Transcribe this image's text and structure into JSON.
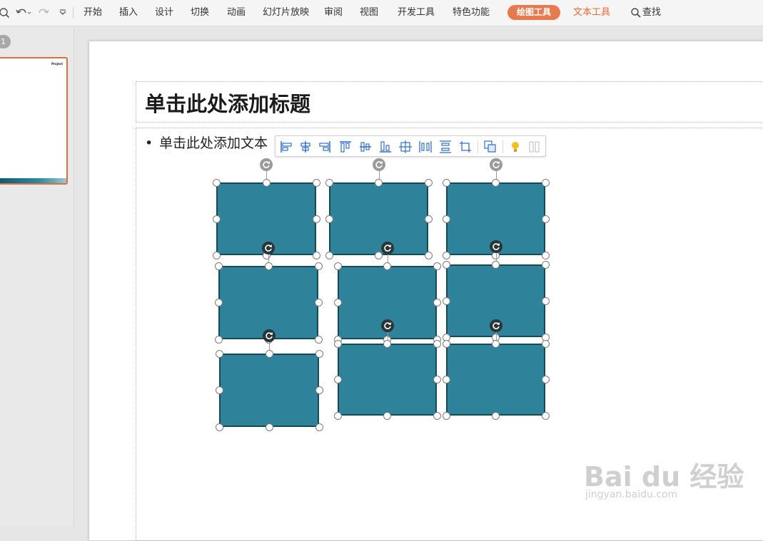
{
  "menubar": {
    "items": [
      "开始",
      "插入",
      "设计",
      "切换",
      "动画",
      "幻灯片放映",
      "审阅",
      "视图",
      "开发工具",
      "特色功能"
    ],
    "drawing_tools_label": "绘图工具",
    "text_tools_label": "文本工具",
    "search_label": "查找",
    "accent_color": "#e8794e"
  },
  "thumbnails": {
    "slide_number": "1",
    "thumb_title": "Project"
  },
  "slide": {
    "title_placeholder": "单击此处添加标题",
    "body_placeholder": "单击此处添加文本",
    "bullet": "•"
  },
  "align_toolbar": {
    "buttons": [
      "align-left",
      "align-center",
      "align-right",
      "align-top",
      "align-middle",
      "align-bottom",
      "distribute-horizontal-center",
      "distribute-horizontally",
      "distribute-vertically",
      "rotate-crop",
      "group-shapes",
      "lightbulb-tip",
      "more-options"
    ]
  },
  "shapes": {
    "count": 9,
    "fill_color": "#2e8299",
    "border_color": "#174a57"
  },
  "watermark": {
    "logo": "Bai du 经验",
    "url": "jingyan.baidu.com"
  }
}
